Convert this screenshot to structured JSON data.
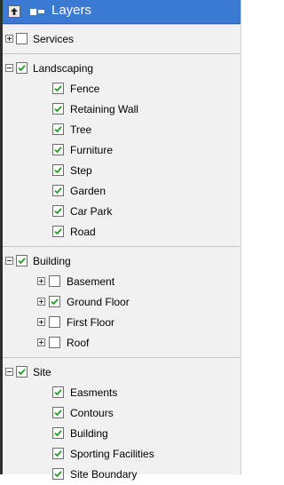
{
  "panel": {
    "title": "Layers",
    "accent": "#3a7ad2"
  },
  "groups": [
    {
      "label": "Services",
      "expanded": false,
      "checked": false,
      "items": []
    },
    {
      "label": "Landscaping",
      "expanded": true,
      "checked": true,
      "items": [
        {
          "label": "Fence",
          "checked": true
        },
        {
          "label": "Retaining Wall",
          "checked": true
        },
        {
          "label": "Tree",
          "checked": true
        },
        {
          "label": "Furniture",
          "checked": true
        },
        {
          "label": "Step",
          "checked": true
        },
        {
          "label": "Garden",
          "checked": true
        },
        {
          "label": "Car Park",
          "checked": true
        },
        {
          "label": "Road",
          "checked": true
        }
      ]
    },
    {
      "label": "Building",
      "expanded": true,
      "checked": true,
      "items": [
        {
          "label": "Basement",
          "checked": false,
          "expandable": true
        },
        {
          "label": "Ground Floor",
          "checked": true,
          "expandable": true
        },
        {
          "label": "First Floor",
          "checked": false,
          "expandable": true
        },
        {
          "label": "Roof",
          "checked": false,
          "expandable": true
        }
      ]
    },
    {
      "label": "Site",
      "expanded": true,
      "checked": true,
      "items": [
        {
          "label": "Easments",
          "checked": true
        },
        {
          "label": "Contours",
          "checked": true
        },
        {
          "label": "Building",
          "checked": true
        },
        {
          "label": "Sporting Facilities",
          "checked": true
        },
        {
          "label": "Site Boundary",
          "checked": true
        }
      ]
    }
  ],
  "icons": {
    "up": "arrow-up-icon",
    "expand_all": "expand-all-icon",
    "collapse_all": "collapse-all-icon",
    "check": "check-icon"
  }
}
